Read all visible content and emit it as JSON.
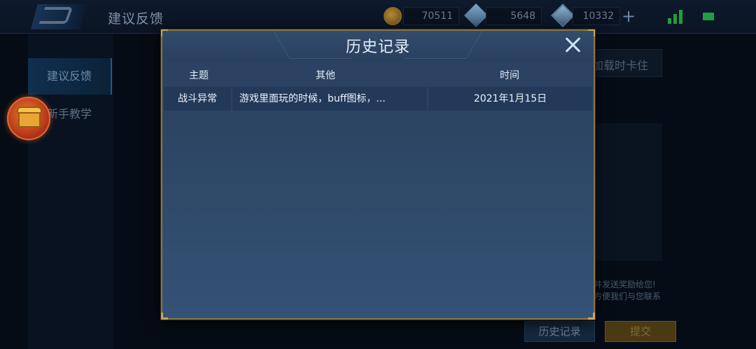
{
  "header": {
    "page_title": "建议反馈",
    "currencies": [
      {
        "name": "gold-coin",
        "value": "70511"
      },
      {
        "name": "diamond",
        "value": "5648"
      },
      {
        "name": "voucher",
        "value": "10332"
      }
    ]
  },
  "sidebar": {
    "items": [
      {
        "label": "建议反馈",
        "active": true
      },
      {
        "label": "新手教学",
        "active": false
      }
    ]
  },
  "background": {
    "partial_option": "加载时卡住",
    "notice_line1": "并发送奖励给您!",
    "notice_line2": "方便我们与您联系",
    "history_button": "历史记录",
    "submit_button": "提交"
  },
  "modal": {
    "title": "历史记录",
    "columns": [
      "主题",
      "其他",
      "时间"
    ],
    "rows": [
      {
        "topic": "战斗异常",
        "other": "游戏里面玩的时候，buff图标，...",
        "time": "2021年1月15日"
      }
    ]
  },
  "colors": {
    "modal_border": "#8b7446",
    "modal_bg": "#2e4766",
    "signal_green": "#1f9e3c"
  }
}
